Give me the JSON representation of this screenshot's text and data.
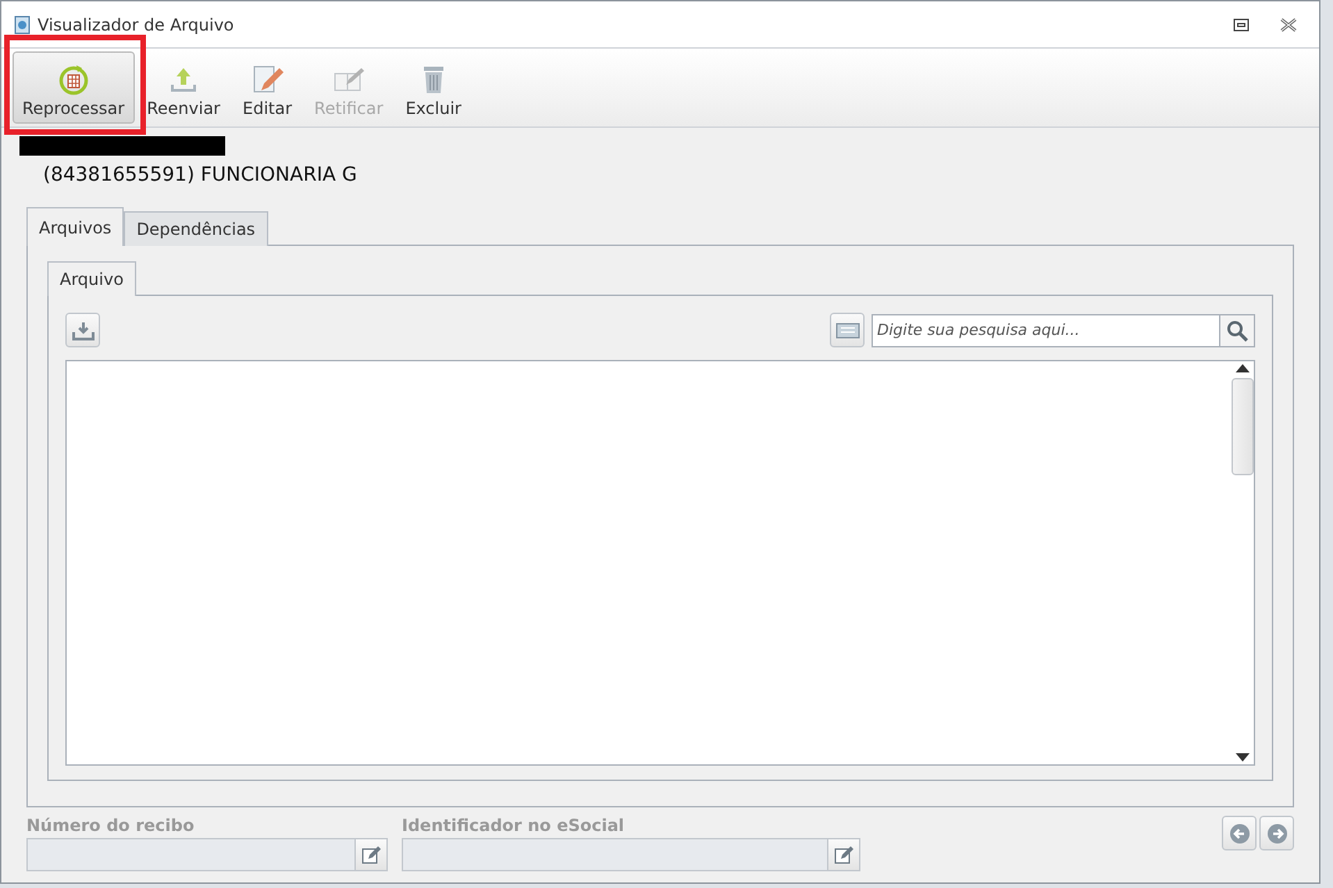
{
  "window": {
    "title": "Visualizador de Arquivo"
  },
  "toolbar": [
    {
      "label": "Reprocessar",
      "kind": "reprocess",
      "disabled": false,
      "highlighted": true
    },
    {
      "label": "Reenviar",
      "kind": "upload",
      "disabled": false,
      "highlighted": false
    },
    {
      "label": "Editar",
      "kind": "edit",
      "disabled": false,
      "highlighted": false
    },
    {
      "label": "Retificar",
      "kind": "rectify",
      "disabled": true,
      "highlighted": false
    },
    {
      "label": "Excluir",
      "kind": "delete",
      "disabled": false,
      "highlighted": false
    }
  ],
  "employee": "(84381655591) FUNCIONARIA G",
  "tabs": [
    {
      "label": "Arquivos",
      "selected": true
    },
    {
      "label": "Dependências",
      "selected": false
    }
  ],
  "inner_tabs": [
    {
      "label": "Arquivo",
      "selected": true
    }
  ],
  "search": {
    "placeholder": "Digite sua pesquisa aqui..."
  },
  "fields": [
    {
      "label": "Número do recibo"
    },
    {
      "label": "Identificador no eSocial"
    }
  ]
}
